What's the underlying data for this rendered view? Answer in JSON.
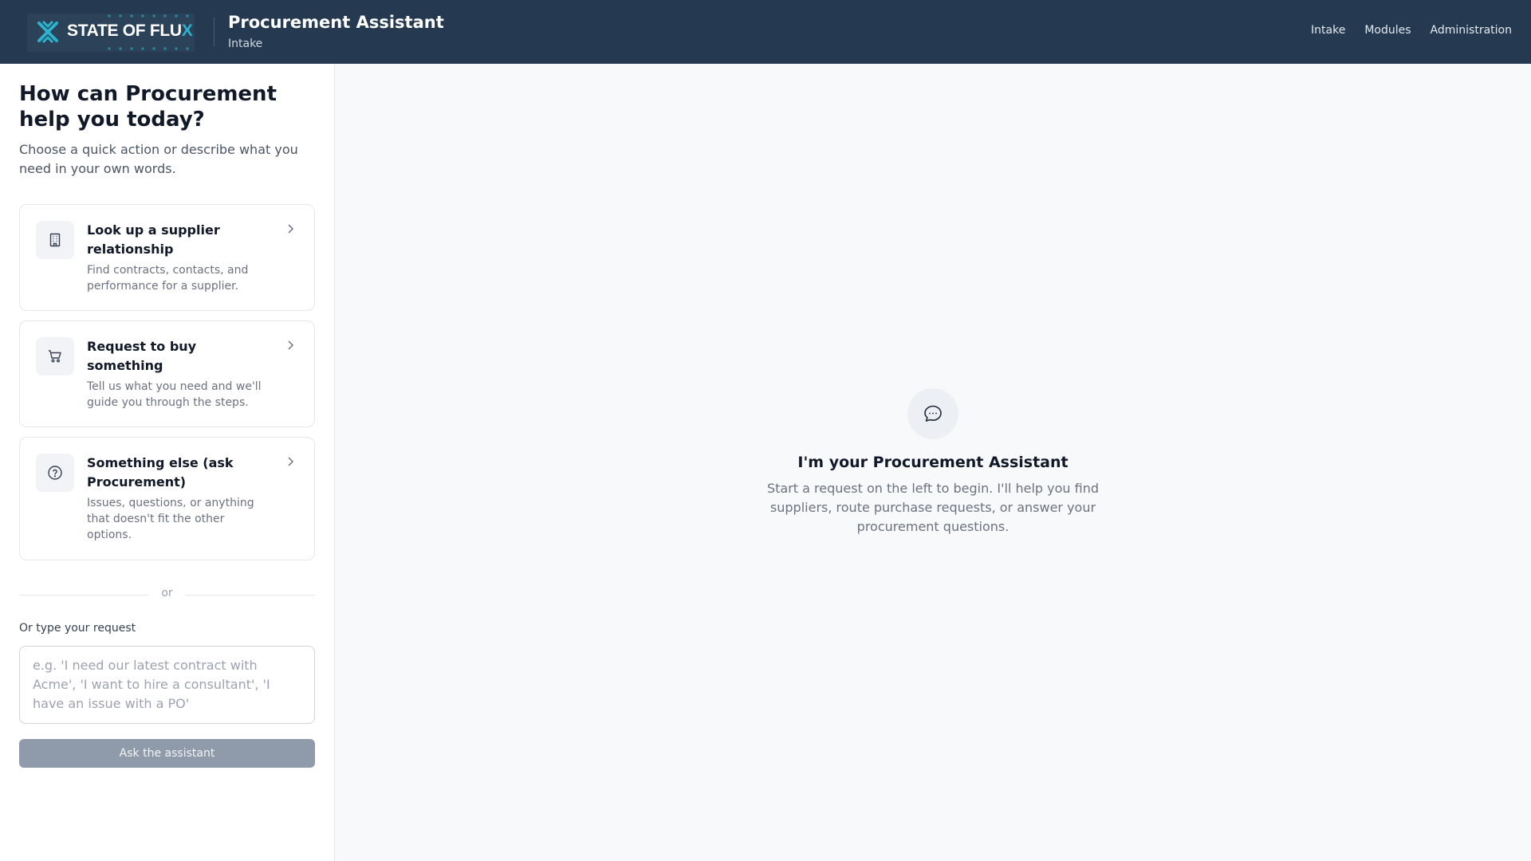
{
  "header": {
    "logo_text_main": "STATE OF FLU",
    "logo_text_accent": "X",
    "title": "Procurement Assistant",
    "subtitle": "Intake",
    "nav": [
      "Intake",
      "Modules",
      "Administration"
    ]
  },
  "left_panel": {
    "heading": "How can Procurement help you today?",
    "subheading": "Choose a quick action or describe what you need in your own words.",
    "actions": [
      {
        "icon": "building-icon",
        "title": "Look up a supplier relationship",
        "description": "Find contracts, contacts, and performance for a supplier."
      },
      {
        "icon": "shopping-cart-icon",
        "title": "Request to buy something",
        "description": "Tell us what you need and we'll guide you through the steps."
      },
      {
        "icon": "question-circle-icon",
        "title": "Something else (ask Procurement)",
        "description": "Issues, questions, or anything that doesn't fit the other options."
      }
    ],
    "divider_text": "or",
    "input_label": "Or type your request",
    "input_placeholder": "e.g. 'I need our latest contract with Acme', 'I want to hire a consultant', 'I have an issue with a PO'",
    "input_value": "",
    "submit_label": "Ask the assistant"
  },
  "empty_state": {
    "icon": "chat-bubble-icon",
    "title": "I'm your Procurement Assistant",
    "description": "Start a request on the left to begin. I'll help you find suppliers, route purchase requests, or answer your procurement questions."
  },
  "colors": {
    "header_bg": "#253a50",
    "brand_accent": "#2bb3cf",
    "button_disabled": "#8f9bab",
    "page_bg": "#f8f9fb"
  }
}
